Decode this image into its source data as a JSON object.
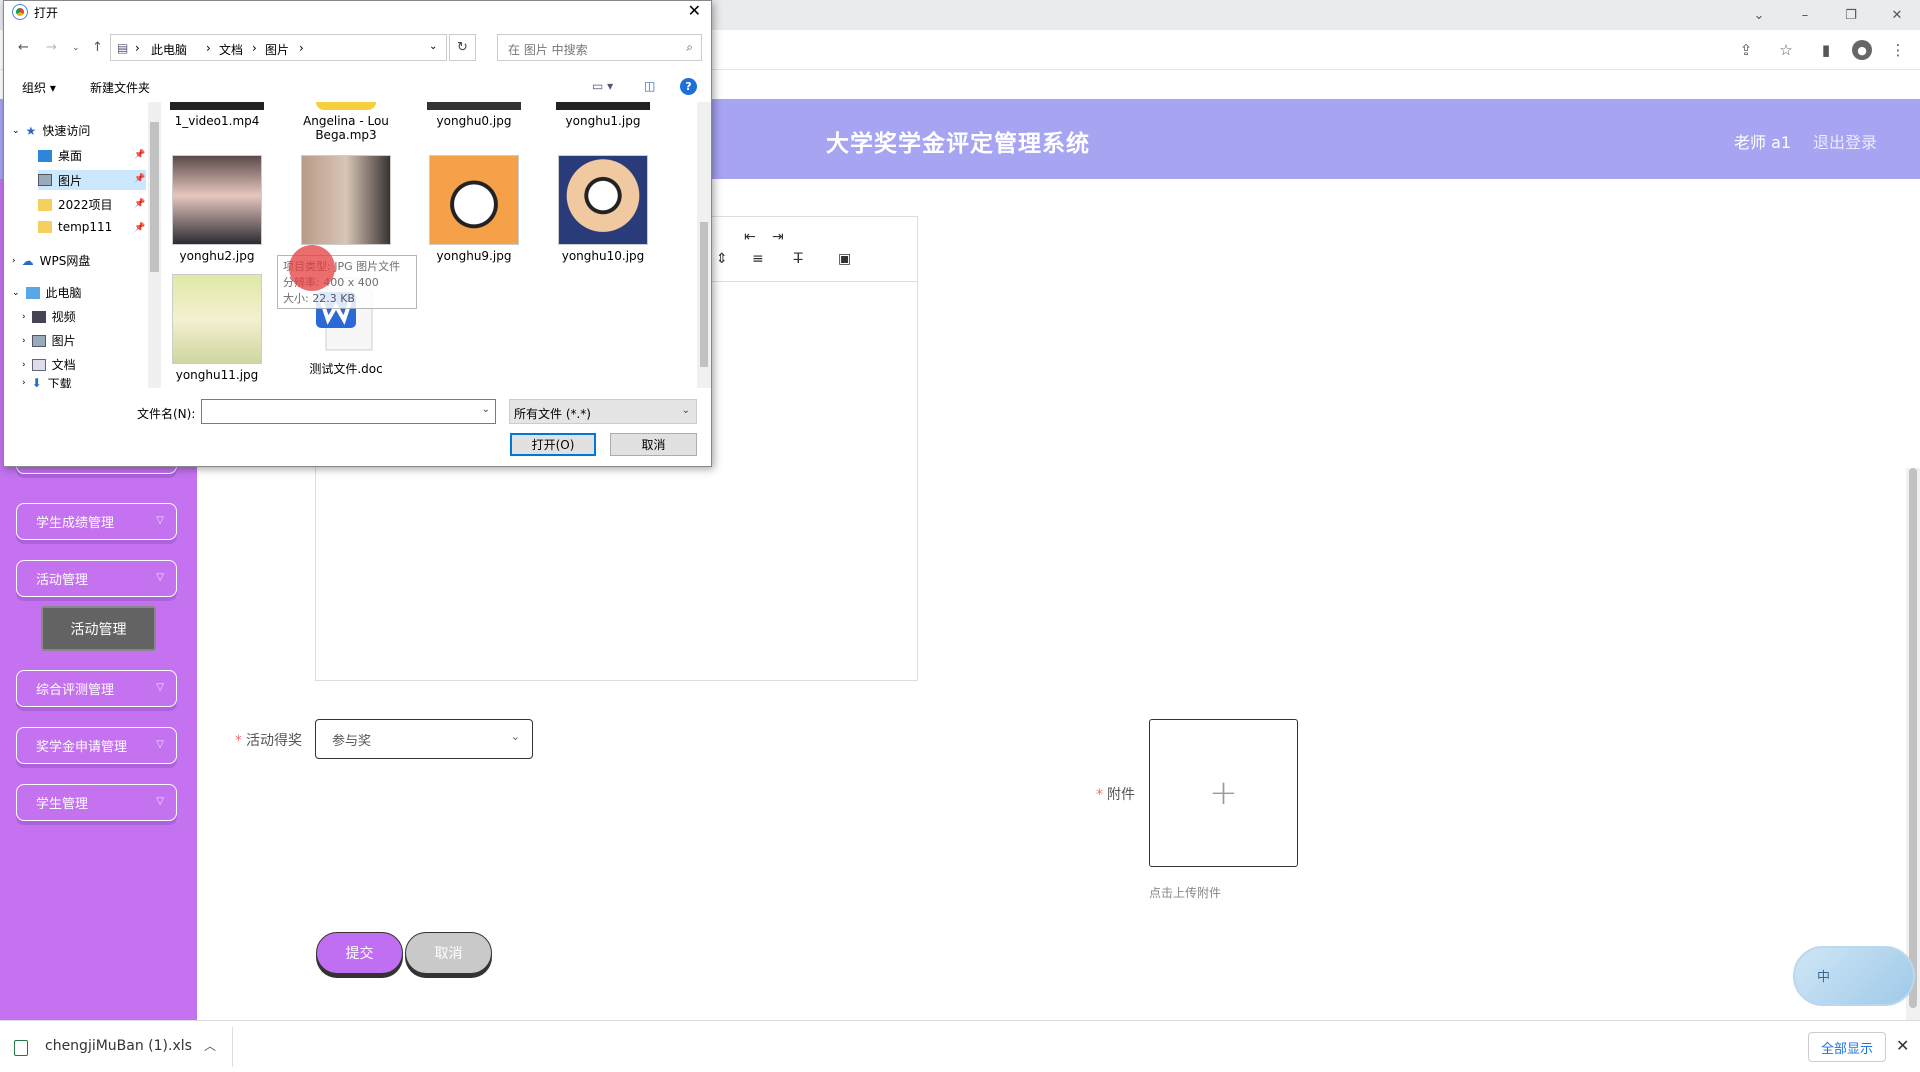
{
  "app": {
    "title": "大学奖学金评定管理系统",
    "user": "老师 a1",
    "logout": "退出登录"
  },
  "sidebar": {
    "items": [
      {
        "label": "学生成绩管理"
      },
      {
        "label": "活动管理"
      },
      {
        "label": "综合评测管理"
      },
      {
        "label": "奖学金申请管理"
      },
      {
        "label": "学生管理"
      }
    ],
    "active_sub": "活动管理"
  },
  "form": {
    "award_label": "活动得奖",
    "award_value": "参与奖",
    "attachment_label": "附件",
    "upload_hint": "点击上传附件",
    "submit": "提交",
    "cancel": "取消"
  },
  "ime": {
    "label": "中"
  },
  "download": {
    "file": "chengjiMuBan (1).xls",
    "show_all": "全部显示"
  },
  "dialog": {
    "title": "打开",
    "path": [
      "此电脑",
      "文档",
      "图片"
    ],
    "search_placeholder": "在 图片 中搜索",
    "organize": "组织 ▾",
    "new_folder": "新建文件夹",
    "nav": {
      "quick_access": "快速访问",
      "desktop": "桌面",
      "pictures": "图片",
      "project2022": "2022项目",
      "temp": "temp111",
      "wps": "WPS网盘",
      "this_pc": "此电脑",
      "videos": "视频",
      "pictures2": "图片",
      "documents": "文档",
      "downloads": "下载"
    },
    "files": {
      "f1": "1_video1.mp4",
      "f2": "Angelina - Lou Bega.mp3",
      "f3": "yonghu0.jpg",
      "f4": "yonghu1.jpg",
      "f5": "yonghu2.jpg",
      "f6": "yonghu9.jpg",
      "f7": "yonghu10.jpg",
      "f8": "yonghu11.jpg",
      "f9": "测试文件.doc"
    },
    "tooltip": {
      "l1": "项目类型: JPG 图片文件",
      "l2": "分辨率: 400 x 400",
      "l3": "大小: 22.3 KB"
    },
    "filename_label": "文件名(N):",
    "filetype": "所有文件 (*.*)",
    "open": "打开(O)",
    "cancel": "取消"
  }
}
